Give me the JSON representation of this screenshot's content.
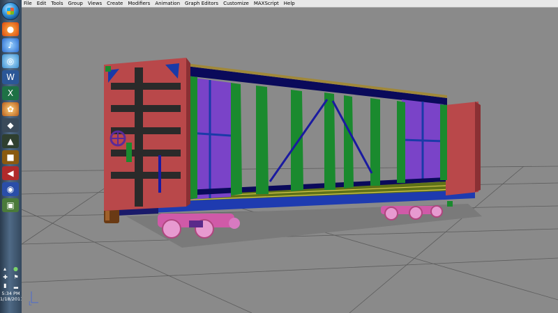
{
  "menu": {
    "items": [
      "File",
      "Edit",
      "Tools",
      "Group",
      "Views",
      "Create",
      "Modifiers",
      "Animation",
      "Graph Editors",
      "Customize",
      "MAXScript",
      "Help"
    ]
  },
  "taskbar": {
    "icons": [
      "firefox-icon",
      "itunes-icon",
      "network-icon",
      "word-icon",
      "excel-icon",
      "photo-app-icon",
      "game-icon",
      "game-icon-2",
      "game-icon-3",
      "volume-icon",
      "webcam-icon",
      "app-icon"
    ],
    "tray": {
      "time": "5:34 PM",
      "date": "1/18/2011"
    }
  },
  "viewport": {
    "background": "#8a8a8a",
    "grid_color": "#5a5a5a",
    "axis_label": "L"
  },
  "colors": {
    "end_wall": "#b9484a",
    "rib": "#1a8a2e",
    "panel": "#7a43c8",
    "frame": "#1a3aa8",
    "roof": "#a08a3a",
    "deck": "#6a7a1a",
    "truck": "#e07ab8"
  }
}
